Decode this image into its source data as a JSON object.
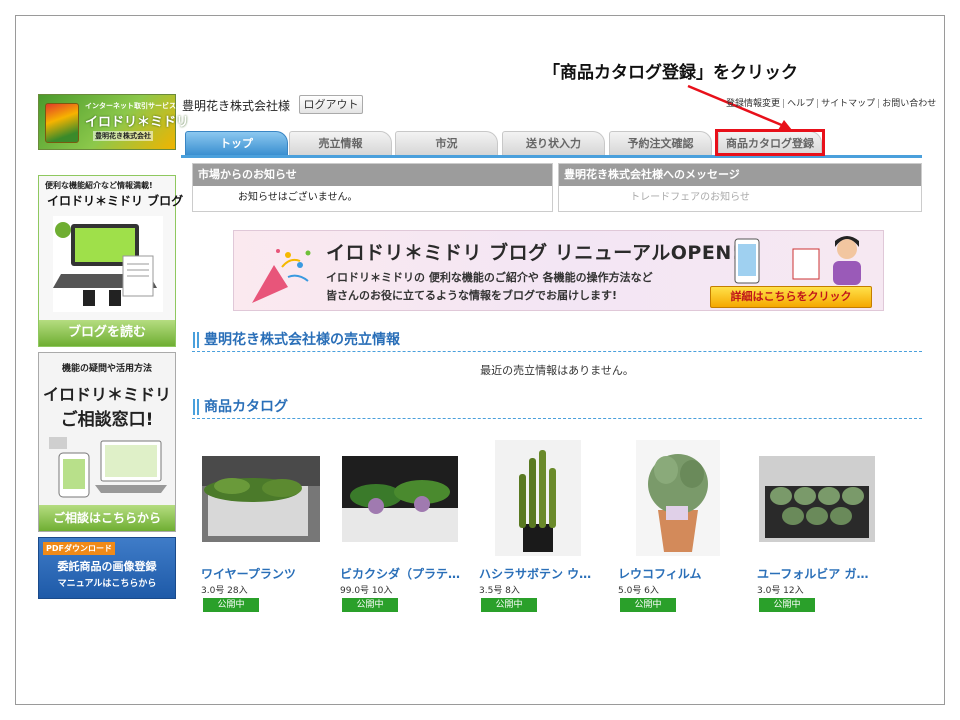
{
  "callout": {
    "text": "「商品カタログ登録」をクリック",
    "color": "#e8101a"
  },
  "logo": {
    "subtitle": "インターネット取引サービス",
    "title": "イロドリ＊ミドリ",
    "company": "豊明花き株式会社"
  },
  "header": {
    "company_name": "豊明花き株式会社様",
    "logout_label": "ログアウト",
    "links": [
      "登録情報変更",
      "ヘルプ",
      "サイトマップ",
      "お問い合わせ"
    ]
  },
  "tabs": [
    {
      "label": "トップ",
      "active": true
    },
    {
      "label": "売立情報",
      "active": false
    },
    {
      "label": "市況",
      "active": false
    },
    {
      "label": "送り状入力",
      "active": false
    },
    {
      "label": "予約注文確認",
      "active": false
    },
    {
      "label": "商品カタログ登録",
      "active": false
    }
  ],
  "sidebar": {
    "blog": {
      "line1": "便利な機能紹介など情報満載!",
      "line2": "イロドリ＊ミドリ ブログ",
      "button": "ブログを読む"
    },
    "consult": {
      "line1": "機能の疑問や活用方法",
      "line2": "イロドリ＊ミドリ",
      "line3": "ご相談窓口!",
      "button": "ご相談はこちらから"
    },
    "pdf": {
      "tag": "PDFダウンロード",
      "line1": "委託商品の画像登録",
      "line2": "マニュアルはこちらから"
    }
  },
  "notices": {
    "market": {
      "title": "市場からのお知らせ",
      "body": "お知らせはございません。"
    },
    "message": {
      "title": "豊明花き株式会社様へのメッセージ",
      "body": "トレードフェアのお知らせ"
    }
  },
  "promo": {
    "title": "イロドリ＊ミドリ ブログ リニューアルOPEN!",
    "line1": "イロドリ＊ミドリの 便利な機能のご紹介や 各機能の操作方法など",
    "line2": "皆さんのお役に立てるような情報をブログでお届けします!",
    "button": "詳細はこちらをクリック"
  },
  "sales": {
    "heading": "豊明花き株式会社様の売立情報",
    "empty_text": "最近の売立情報はありません。"
  },
  "catalog": {
    "heading": "商品カタログ",
    "products": [
      {
        "name": "ワイヤープランツ",
        "spec": "3.0号 28入",
        "status": "公開中"
      },
      {
        "name": "ビカクシダ（プラテ…",
        "spec": "99.0号 10入",
        "status": "公開中"
      },
      {
        "name": "ハシラサボテン ウ…",
        "spec": "3.5号 8入",
        "status": "公開中"
      },
      {
        "name": "レウコフィルム",
        "spec": "5.0号 6入",
        "status": "公開中"
      },
      {
        "name": "ユーフォルビア ガ…",
        "spec": "3.0号 12入",
        "status": "公開中"
      }
    ]
  }
}
